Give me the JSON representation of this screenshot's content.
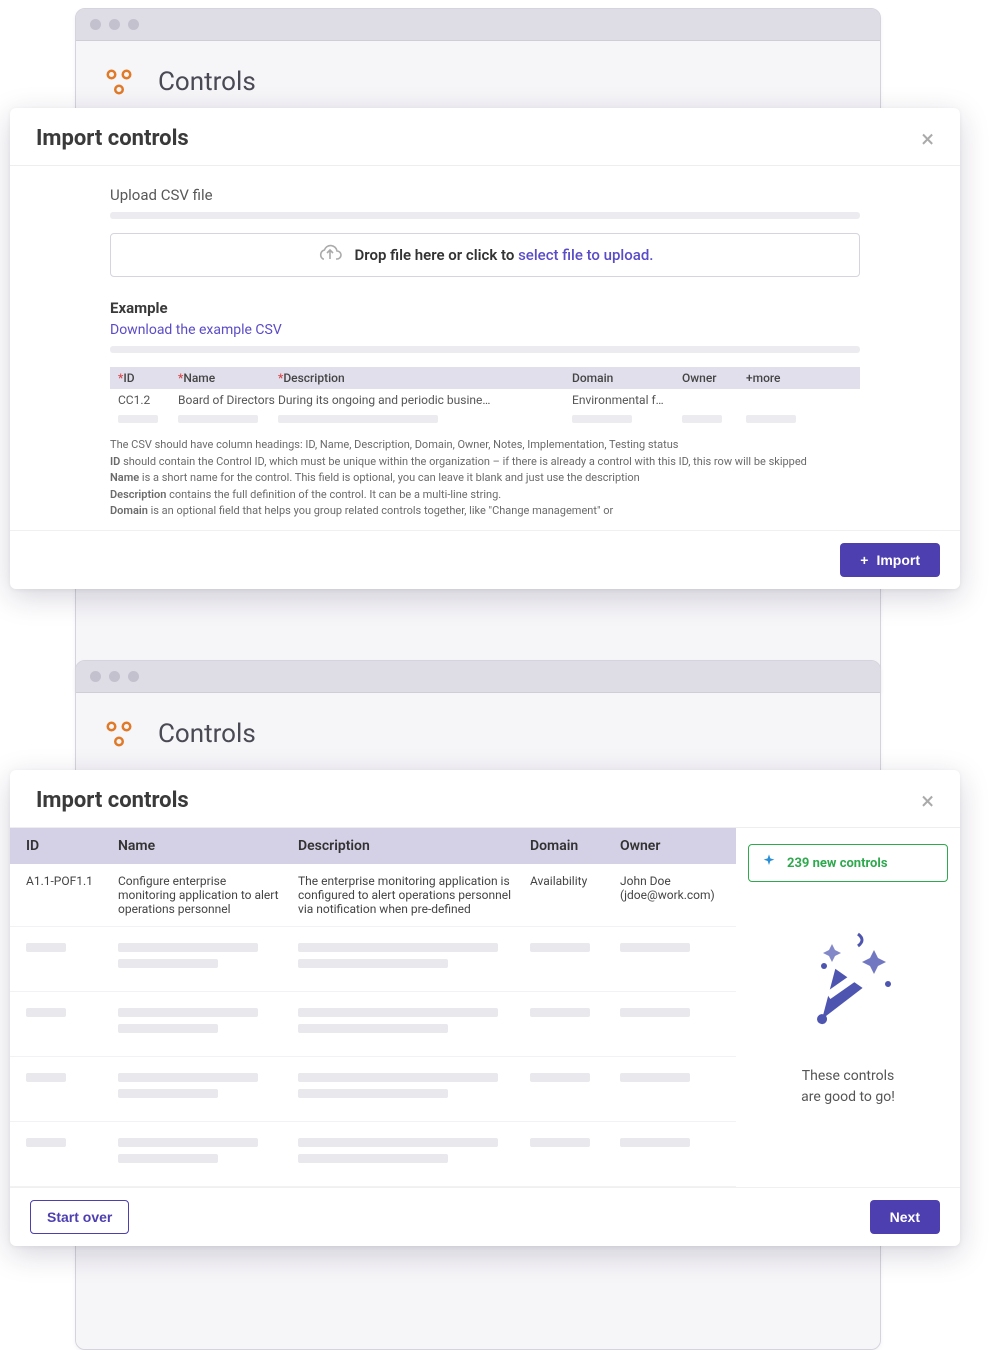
{
  "app": {
    "title": "Controls"
  },
  "modal1": {
    "title": "Import controls",
    "upload_label": "Upload CSV file",
    "drop_text_prefix": "Drop file here or click to ",
    "drop_text_link": "select file to upload.",
    "example_heading": "Example",
    "download_link": "Download the example CSV",
    "columns": {
      "id": "ID",
      "name": "Name",
      "description": "Description",
      "domain": "Domain",
      "owner": "Owner",
      "more": "+more"
    },
    "sample": {
      "id": "CC1.2",
      "name": "Board of Directors",
      "description": "During its ongoing and periodic busine…",
      "domain": "Environmental f…"
    },
    "help": {
      "l1": "The CSV should have column headings: ID, Name, Description, Domain, Owner, Notes, Implementation, Testing status",
      "l2_b": "ID",
      "l2": " should contain the Control ID, which must be unique within the organization – if there is already a control with this ID, this row will be skipped",
      "l3_b": "Name",
      "l3": " is a short name for the control. This field is optional, you can leave it blank and just use the description",
      "l4_b": "Description",
      "l4": " contains the full definition of the control. It can be a multi-line string.",
      "l5_b": "Domain",
      "l5": " is an optional field that helps you group related controls together, like \"Change management\" or"
    },
    "import_btn": "Import"
  },
  "modal2": {
    "title": "Import controls",
    "columns": {
      "id": "ID",
      "name": "Name",
      "description": "Description",
      "domain": "Domain",
      "owner": "Owner"
    },
    "row": {
      "id": "A1.1-POF1.1",
      "name": "Configure enterprise monitoring application to alert operations personnel",
      "description": "The enterprise monitoring application is configured to alert operations personnel via notification when pre-defined",
      "domain": "Availability",
      "owner_name": "John Doe",
      "owner_email": "(jdoe@work.com)"
    },
    "badge_text": "239 new controls",
    "celebrate_line1": "These controls",
    "celebrate_line2": "are good to go!",
    "start_over": "Start over",
    "next": "Next"
  }
}
